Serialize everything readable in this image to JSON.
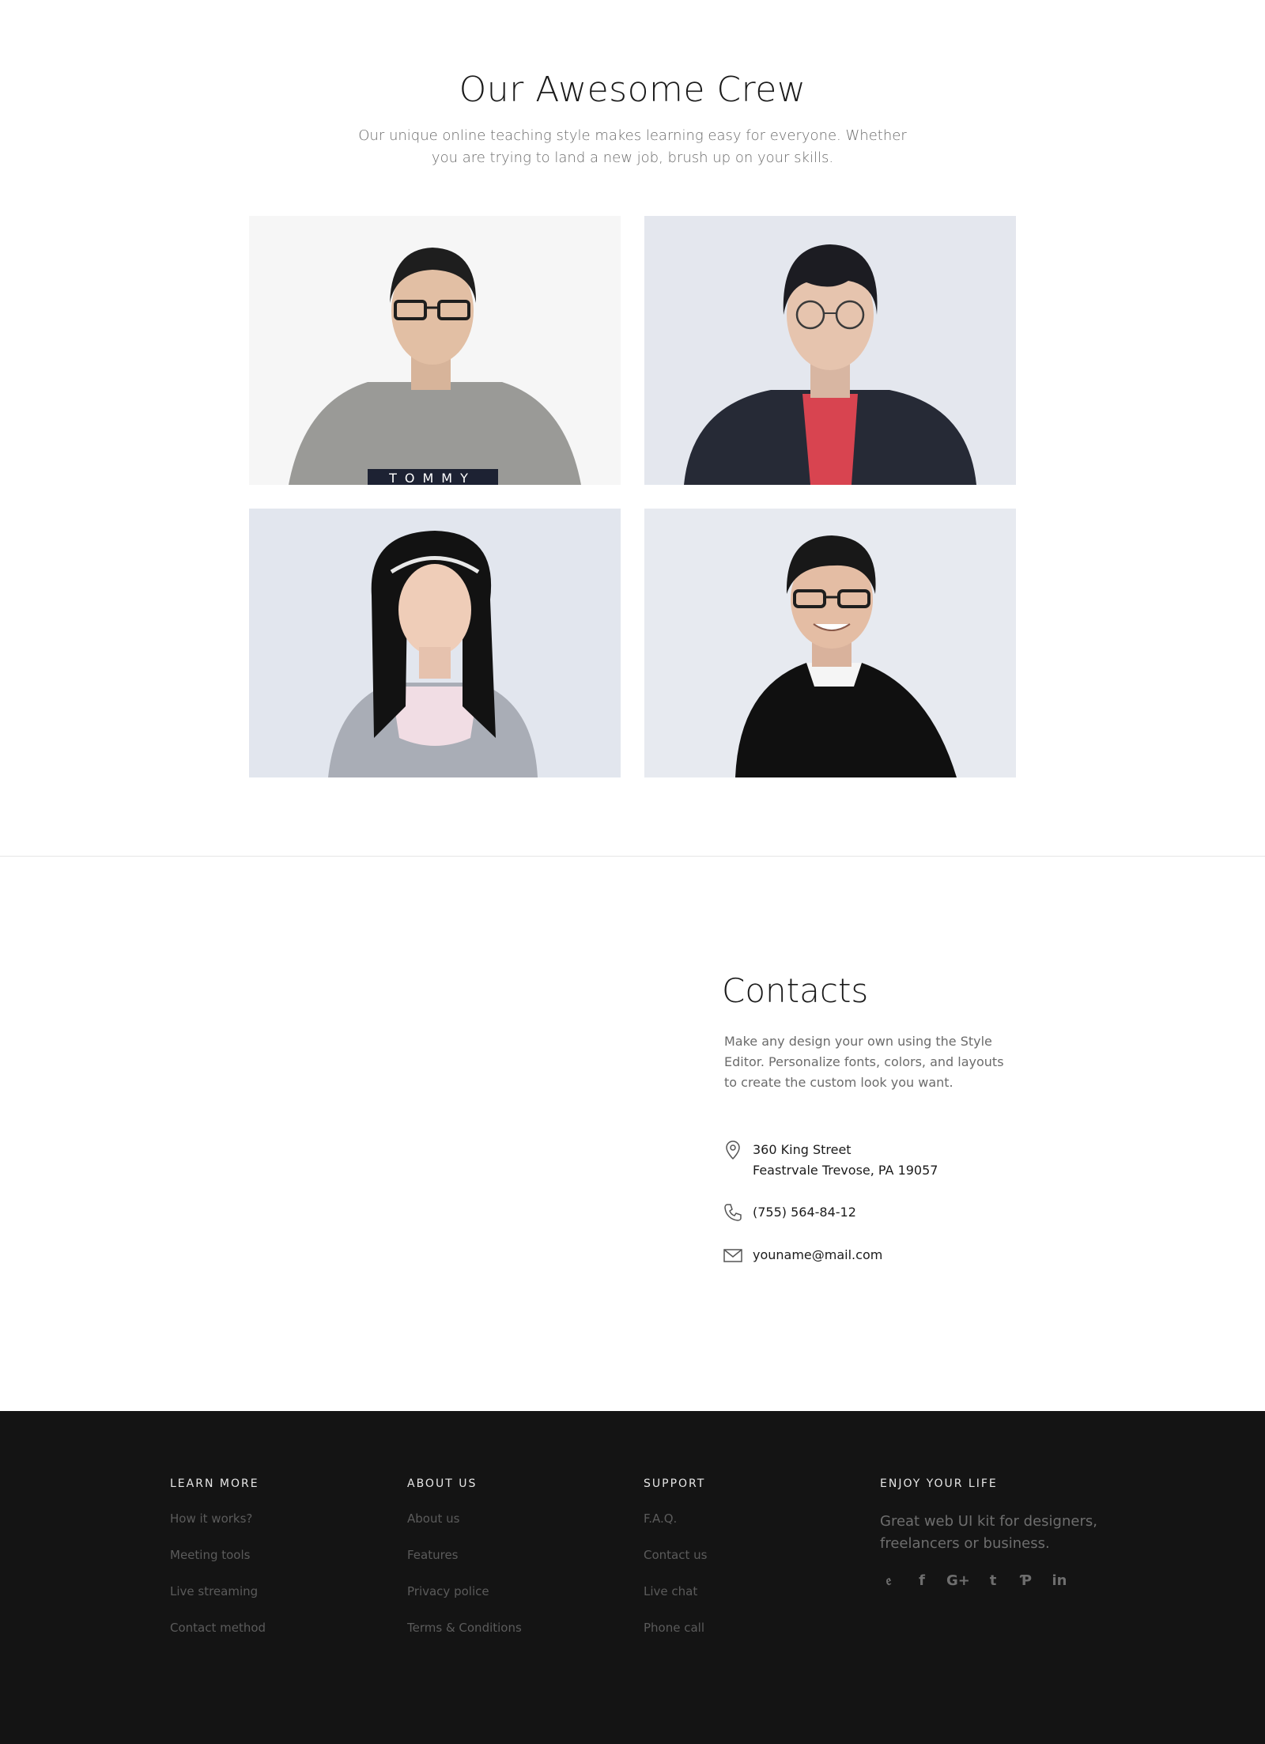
{
  "crew": {
    "title": "Our Awesome Crew",
    "subtitle": "Our unique online teaching style makes learning easy for everyone. Whether you are trying to land a new job, brush up on your skills."
  },
  "contacts": {
    "title": "Contacts",
    "description": "Make any design your own using the Style Editor. Personalize fonts, colors, and layouts to create the custom look you want.",
    "address_line1": "360 King Street",
    "address_line2": "Feastrvale Trevose, PA 19057",
    "phone": "(755) 564-84-12",
    "email": "youname@mail.com"
  },
  "footer": {
    "col1": {
      "heading": "LEARN MORE",
      "links": [
        "How it works?",
        "Meeting tools",
        "Live streaming",
        "Contact method"
      ]
    },
    "col2": {
      "heading": "ABOUT US",
      "links": [
        "About us",
        "Features",
        "Privacy police",
        "Terms & Conditions"
      ]
    },
    "col3": {
      "heading": "SUPPORT",
      "links": [
        "F.A.Q.",
        "Contact us",
        "Live chat",
        "Phone call"
      ]
    },
    "col4": {
      "heading": "ENJOY YOUR LIFE",
      "tagline": "Great web UI kit for designers, freelancers or business.",
      "social": [
        "twitter-icon",
        "facebook-icon",
        "google-plus-icon",
        "tumblr-icon",
        "pinterest-icon",
        "linkedin-icon"
      ]
    }
  },
  "colors": {
    "footer_bg": "#141414",
    "heading": "#1b1b1b",
    "muted": "#6b6b6b"
  }
}
